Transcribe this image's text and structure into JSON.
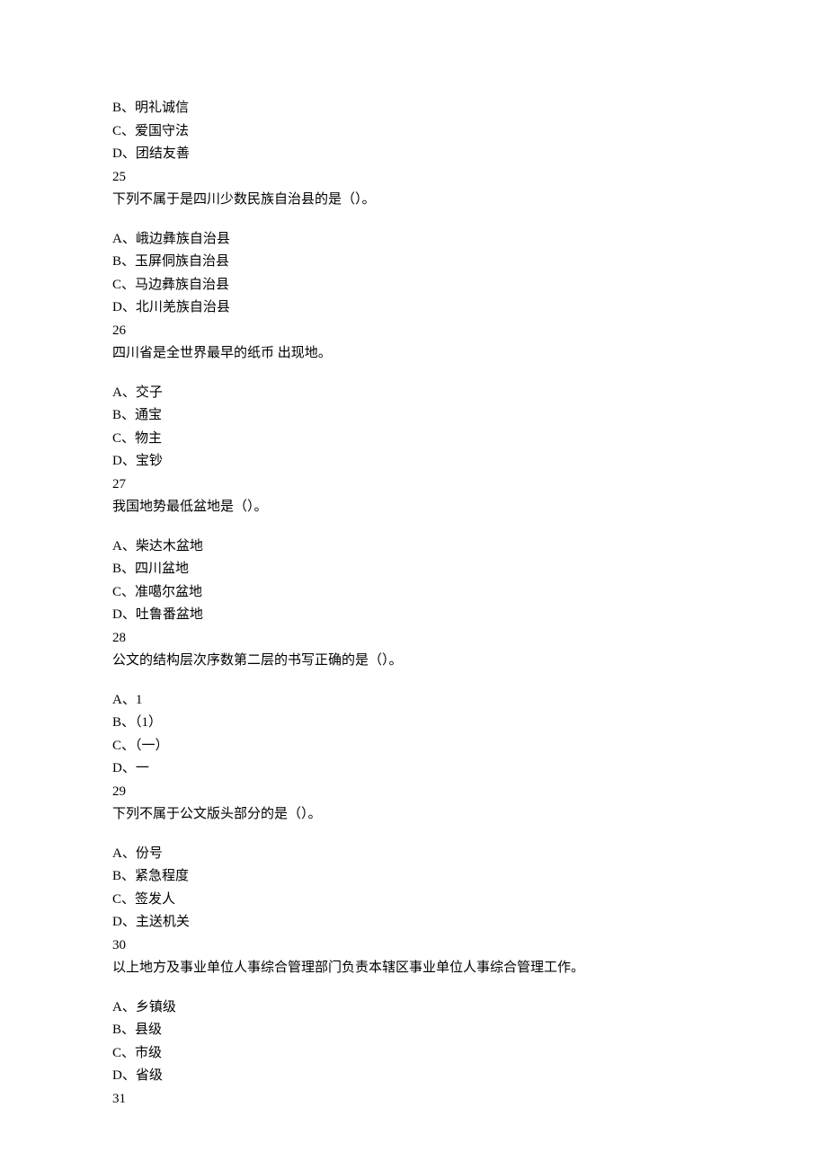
{
  "pre_options": [
    "B、明礼诚信",
    "C、爱国守法",
    "D、团结友善"
  ],
  "questions": [
    {
      "num": "25",
      "stem": "下列不属于是四川少数民族自治县的是（）。",
      "options": [
        "A、峨边彝族自治县",
        "B、玉屏侗族自治县",
        "C、马边彝族自治县",
        "D、北川羌族自治县"
      ]
    },
    {
      "num": "26",
      "stem": "四川省是全世界最早的纸币 出现地。",
      "options": [
        "A、交子",
        "B、通宝",
        "C、物主",
        "D、宝钞"
      ]
    },
    {
      "num": "27",
      "stem": "我国地势最低盆地是（）。",
      "options": [
        "A、柴达木盆地",
        "B、四川盆地",
        "C、准噶尔盆地",
        "D、吐鲁番盆地"
      ]
    },
    {
      "num": "28",
      "stem": "公文的结构层次序数第二层的书写正确的是（）。",
      "options": [
        "A、1",
        "B、（1）",
        "C、（一）",
        "D、一"
      ]
    },
    {
      "num": "29",
      "stem": "下列不属于公文版头部分的是（）。",
      "options": [
        "A、份号",
        "B、紧急程度",
        "C、签发人",
        "D、主送机关"
      ]
    },
    {
      "num": "30",
      "stem": "以上地方及事业单位人事综合管理部门负责本辖区事业单位人事综合管理工作。",
      "options": [
        "A、乡镇级",
        "B、县级",
        "C、市级",
        "D、省级"
      ]
    }
  ],
  "trailing_num": "31"
}
